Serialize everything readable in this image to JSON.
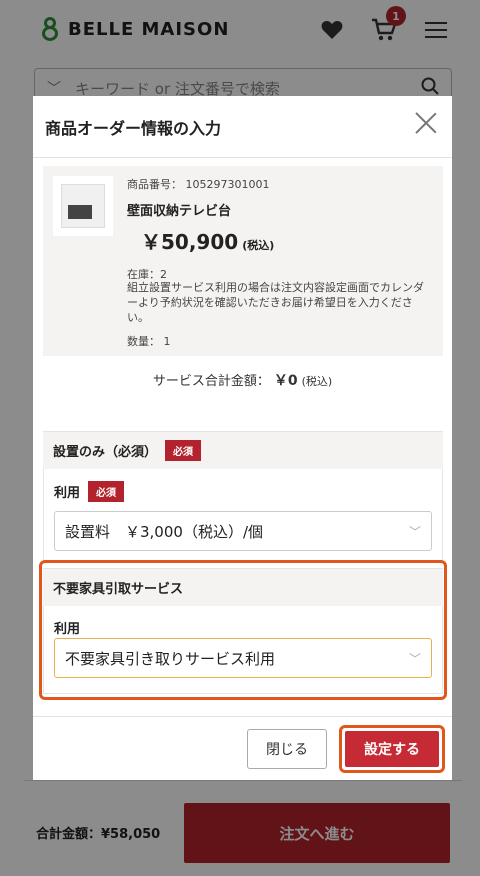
{
  "header": {
    "logo_text": "BELLE MAISON",
    "cart_count": "1"
  },
  "search": {
    "placeholder": "キーワード or 注文番号で検索"
  },
  "footer": {
    "total_label": "合計金額：¥58,050",
    "checkout_label": "注文へ進む"
  },
  "modal": {
    "title": "商品オーダー情報の入力",
    "product": {
      "number": "商品番号： 105297301001",
      "name": "壁面収納テレビ台",
      "price": "￥50,900",
      "price_tax": "(税込)",
      "stock": "在庫：2",
      "note": "組立設置サービス利用の場合は注文内容設定画面でカレンダーより予約状況を確認いただきお届け希望日を入力ください。",
      "quantity": "数量： 1"
    },
    "service_total": {
      "label": "サービス合計金額：",
      "value": "￥0",
      "tax": "(税込)"
    },
    "section1": {
      "title": "設置のみ（必須）",
      "badge": "必須",
      "field_label": "利用",
      "field_badge": "必須",
      "selected": "設置料　￥3,000（税込）/個"
    },
    "section2": {
      "title": "不要家具引取サービス",
      "field_label": "利用",
      "selected": "不要家具引き取りサービス利用"
    },
    "buttons": {
      "close": "閉じる",
      "confirm": "設定する"
    }
  },
  "colors": {
    "accent": "#b3232d",
    "highlight": "#e0561c",
    "logo_green": "#2f8f3a"
  }
}
